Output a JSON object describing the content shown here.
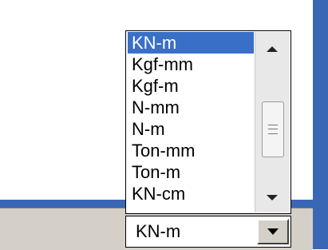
{
  "dropdown": {
    "items": [
      {
        "label": "KN-m",
        "selected": true
      },
      {
        "label": "Kgf-mm",
        "selected": false
      },
      {
        "label": "Kgf-m",
        "selected": false
      },
      {
        "label": "N-mm",
        "selected": false
      },
      {
        "label": "N-m",
        "selected": false
      },
      {
        "label": "Ton-mm",
        "selected": false
      },
      {
        "label": "Ton-m",
        "selected": false
      },
      {
        "label": "KN-cm",
        "selected": false
      }
    ]
  },
  "combo": {
    "value": "KN-m"
  },
  "colors": {
    "selection": "#3a6fc7",
    "frame_blue": "#3a66b6",
    "panel_gray": "#d4d0c8"
  }
}
